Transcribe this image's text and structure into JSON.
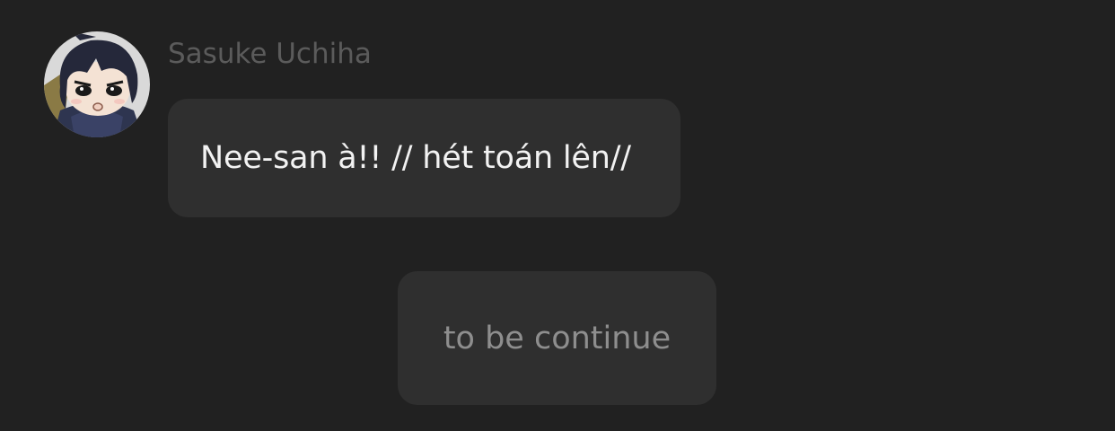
{
  "chat": {
    "messages": [
      {
        "sender": "Sasuke Uchiha",
        "avatar_icon": "chibi-character-avatar",
        "text": "Nee-san à!! // hét toán lên//"
      },
      {
        "text": "to be continue"
      }
    ]
  },
  "colors": {
    "background": "#212121",
    "bubble": "#2f2f2f",
    "sender_name": "#5b5b5b",
    "message_text": "#f2f2f2",
    "muted_text": "#8e8e8e"
  }
}
